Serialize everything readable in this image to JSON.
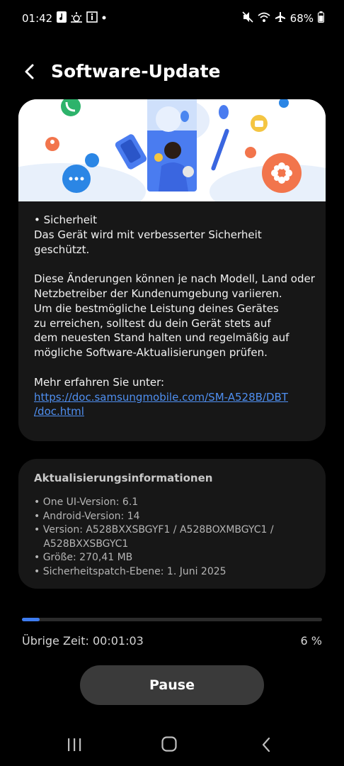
{
  "status_bar": {
    "time": "01:42",
    "battery": "68%",
    "left_icons": [
      "music-note-icon",
      "weather-icon",
      "info-box-icon",
      "dot-icon"
    ],
    "right_icons": [
      "mute-icon",
      "wifi-icon",
      "airplane-icon",
      "battery-icon"
    ]
  },
  "header": {
    "title": "Software-Update"
  },
  "release_notes": {
    "text": "• Sicherheit\nDas Gerät wird mit verbesserter Sicherheit\ngeschützt.\n\nDiese Änderungen können je nach Modell, Land oder\nNetzbetreiber der Kundenumgebung variieren.\nUm die bestmögliche Leistung deines Gerätes\nzu erreichen, solltest du dein Gerät stets auf\ndem neuesten Stand halten und regelmäßig auf\nmögliche Software-Aktualisierungen prüfen.\n\nMehr erfahren Sie unter:",
    "link_line1": "https://doc.samsungmobile.com/SM-A528B/DBT",
    "link_line2": "/doc.html"
  },
  "update_info": {
    "heading": "Aktualisierungsinformationen",
    "items": [
      "• One UI-Version: 6.1",
      "• Android-Version: 14",
      "• Version: A528BXXSBGYF1 / A528BOXMBGYC1 /",
      "   A528BXXSBGYC1",
      "• Größe: 270,41 MB",
      "• Sicherheitspatch-Ebene: 1. Juni 2025"
    ]
  },
  "download": {
    "remaining_label": "Übrige Zeit: 00:01:03",
    "percent_label": "6 %",
    "progress": 0.06
  },
  "buttons": {
    "pause": "Pause"
  },
  "colors": {
    "accent": "#3e7cf0",
    "link": "#4f8ff0",
    "card": "#171717",
    "button": "#3a3a3a"
  }
}
